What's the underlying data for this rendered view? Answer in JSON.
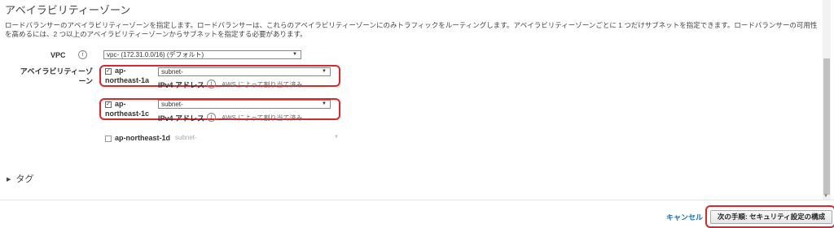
{
  "section": {
    "title": "アベイラビリティーゾーン",
    "description": "ロードバランサーのアベイラビリティーゾーンを指定します。ロードバランサーは、これらのアベイラビリティーゾーンにのみトラフィックをルーティングします。アベイラビリティーゾーンごとに 1 つだけサブネットを指定できます。ロードバランサーの可用性を高めるには、2 つ以上のアベイラビリティーゾーンからサブネットを指定する必要があります。"
  },
  "vpc": {
    "label": "VPC",
    "info_icon": "info-icon",
    "selected": "vpc-        (172.31.0.0/16) (デフォルト)"
  },
  "az": {
    "label": "アベイラビリティーゾーン",
    "zones": [
      {
        "name_line1": "ap-",
        "name_line2": "northeast-1a",
        "checked": true,
        "subnet": "subnet-",
        "ipv4_label": "IPv4 アドレス",
        "ipv4_value": "AWS によって割り当て済み"
      },
      {
        "name_line1": "ap-",
        "name_line2": "northeast-1c",
        "checked": true,
        "subnet": "subnet-",
        "ipv4_label": "IPv4 アドレス",
        "ipv4_value": "AWS によって割り当て済み"
      },
      {
        "name": "ap-northeast-1d",
        "checked": false,
        "subnet": "subnet-"
      }
    ]
  },
  "tags": {
    "label": "タグ",
    "caret": "▶"
  },
  "footer": {
    "cancel_label": "キャンセル",
    "next_label": "次の手順: セキュリティ設定の構成"
  },
  "colors": {
    "highlight": "#d9272e",
    "link": "#1a6fb8"
  }
}
